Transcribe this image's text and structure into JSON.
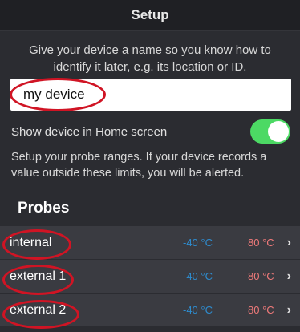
{
  "navbar": {
    "title": "Setup"
  },
  "intro": {
    "text": "Give your device a name so you know how to identify it later, e.g. its location or ID."
  },
  "name_field": {
    "value": "my device"
  },
  "home_toggle": {
    "label": "Show device in Home screen",
    "on": true
  },
  "hint": {
    "text": "Setup your probe ranges. If your device records a value outside these limits, you will be alerted."
  },
  "probes": {
    "header": "Probes",
    "items": [
      {
        "name": "internal",
        "min": "-40 °C",
        "max": "80 °C"
      },
      {
        "name": "external 1",
        "min": "-40 °C",
        "max": "80 °C"
      },
      {
        "name": "external 2",
        "min": "-40 °C",
        "max": "80 °C"
      }
    ]
  },
  "colors": {
    "toggle_on": "#4cd964",
    "min_value": "#2e8ccf",
    "max_value": "#f07a7a",
    "annotation": "#d01424"
  },
  "icons": {
    "chevron": "chevron-right-icon"
  }
}
